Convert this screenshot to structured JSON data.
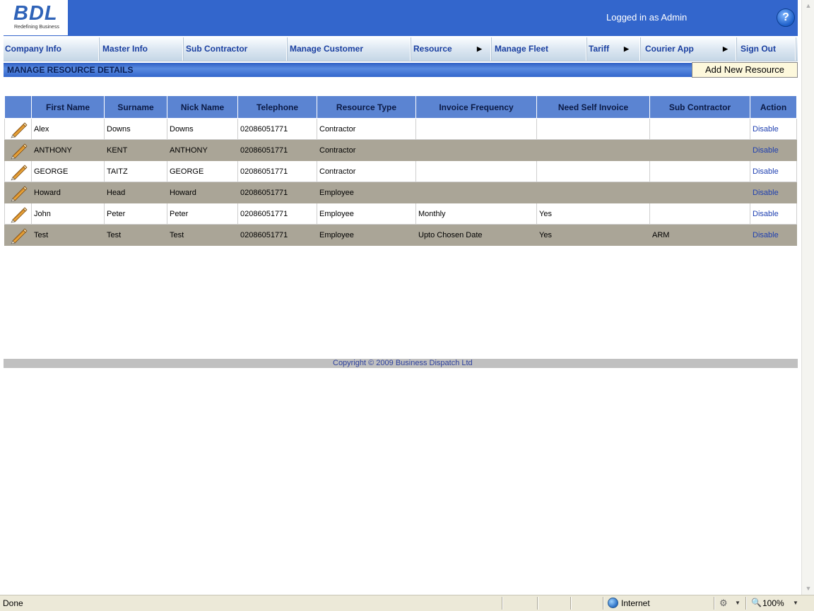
{
  "header": {
    "logo_text": "BDL",
    "logo_tagline": "Redefining Business",
    "logged_in": "Logged in as Admin",
    "help_glyph": "?"
  },
  "nav": [
    {
      "label": "Company Info",
      "has_submenu": false
    },
    {
      "label": "Master Info",
      "has_submenu": false
    },
    {
      "label": "Sub Contractor",
      "has_submenu": false
    },
    {
      "label": "Manage Customer",
      "has_submenu": false
    },
    {
      "label": "Resource",
      "has_submenu": true
    },
    {
      "label": "Manage Fleet",
      "has_submenu": false
    },
    {
      "label": "Tariff",
      "has_submenu": true
    },
    {
      "label": "Courier App",
      "has_submenu": true
    },
    {
      "label": "Sign Out",
      "has_submenu": false
    }
  ],
  "page": {
    "title": "MANAGE RESOURCE DETAILS",
    "add_button": "Add New Resource"
  },
  "table": {
    "columns": [
      "",
      "First Name",
      "Surname",
      "Nick Name",
      "Telephone",
      "Resource Type",
      "Invoice Frequency",
      "Need Self Invoice",
      "Sub Contractor",
      "Action"
    ],
    "rows": [
      {
        "first": "Alex",
        "surname": "Downs",
        "nick": "Downs",
        "tel": "02086051771",
        "type": "Contractor",
        "freq": "",
        "self_invoice": "",
        "sub": "",
        "action": "Disable"
      },
      {
        "first": "ANTHONY",
        "surname": "KENT",
        "nick": "ANTHONY",
        "tel": "02086051771",
        "type": "Contractor",
        "freq": "",
        "self_invoice": "",
        "sub": "",
        "action": "Disable"
      },
      {
        "first": "GEORGE",
        "surname": "TAITZ",
        "nick": "GEORGE",
        "tel": "02086051771",
        "type": "Contractor",
        "freq": "",
        "self_invoice": "",
        "sub": "",
        "action": "Disable"
      },
      {
        "first": "Howard",
        "surname": "Head",
        "nick": "Howard",
        "tel": "02086051771",
        "type": "Employee",
        "freq": "",
        "self_invoice": "",
        "sub": "",
        "action": "Disable"
      },
      {
        "first": "John",
        "surname": "Peter",
        "nick": "Peter",
        "tel": "02086051771",
        "type": "Employee",
        "freq": "Monthly",
        "self_invoice": "Yes",
        "sub": "",
        "action": "Disable"
      },
      {
        "first": "Test",
        "surname": "Test",
        "nick": "Test",
        "tel": "02086051771",
        "type": "Employee",
        "freq": "Upto Chosen Date",
        "self_invoice": "Yes",
        "sub": "ARM",
        "action": "Disable"
      }
    ]
  },
  "footer": {
    "copyright": "Copyright © 2009 Business Dispatch Ltd"
  },
  "statusbar": {
    "status": "Done",
    "zone": "Internet",
    "zoom": "100%"
  },
  "colors": {
    "header_blue": "#3366cc",
    "alt_row": "#aaa597",
    "link_blue": "#1e3fb0"
  }
}
